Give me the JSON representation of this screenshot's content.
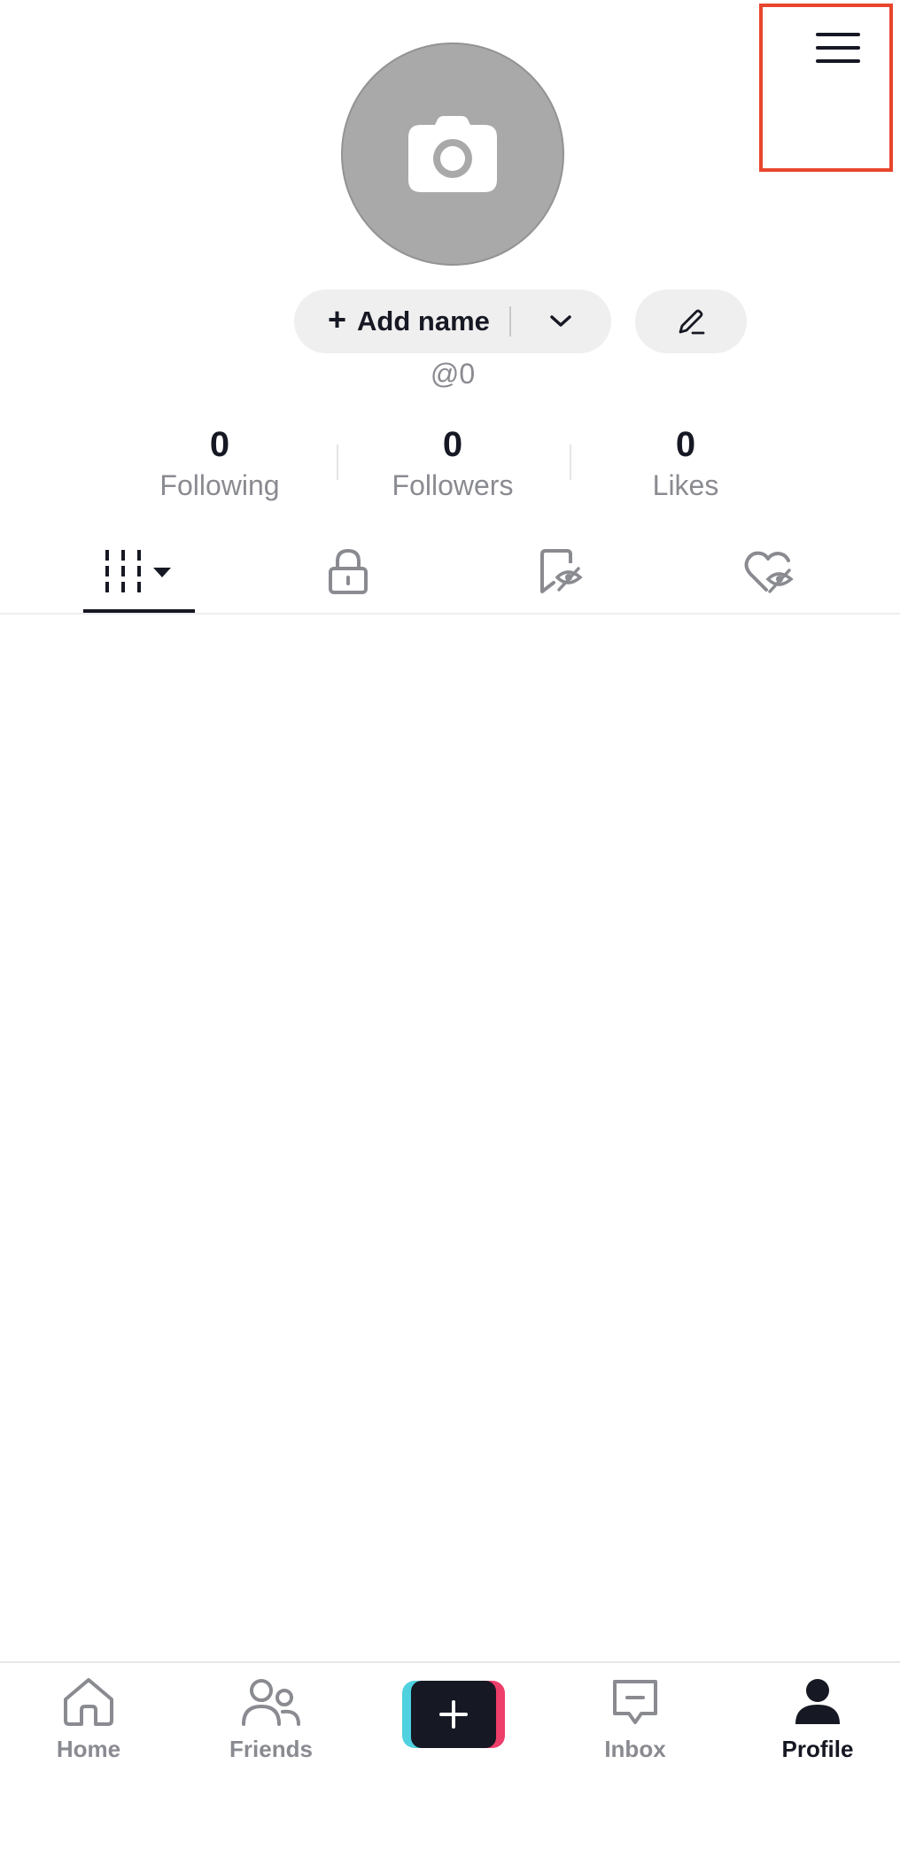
{
  "header": {
    "menu_icon": "hamburger-menu-icon"
  },
  "profile": {
    "avatar_icon": "camera-icon",
    "add_name_label": "Add name",
    "username": "@0"
  },
  "stats": [
    {
      "value": "0",
      "label": "Following"
    },
    {
      "value": "0",
      "label": "Followers"
    },
    {
      "value": "0",
      "label": "Likes"
    }
  ],
  "tabs": [
    {
      "icon": "videos-grid-icon",
      "selected": true
    },
    {
      "icon": "lock-icon",
      "selected": false
    },
    {
      "icon": "bookmark-hidden-icon",
      "selected": false
    },
    {
      "icon": "heart-hidden-icon",
      "selected": false
    }
  ],
  "bottom_nav": {
    "home_label": "Home",
    "friends_label": "Friends",
    "inbox_label": "Inbox",
    "profile_label": "Profile"
  },
  "colors": {
    "highlight": "#e8452c",
    "text_primary": "#161823",
    "text_secondary": "#8a8b91",
    "create_cyan": "#4fd1e0",
    "create_pink": "#ee3e6a"
  }
}
